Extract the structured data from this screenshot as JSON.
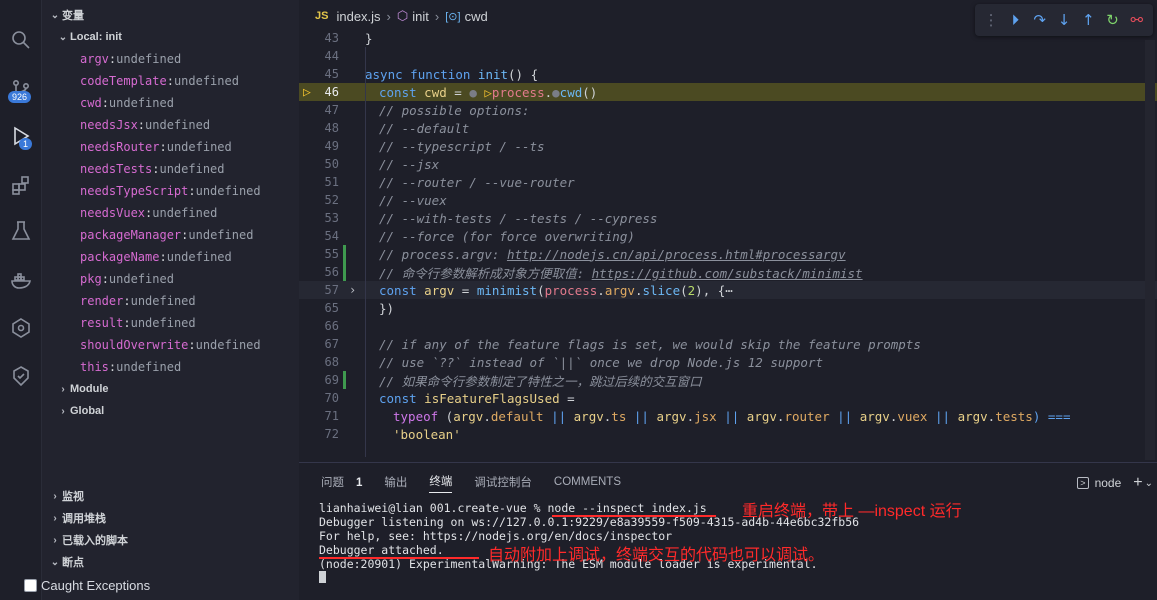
{
  "activity": {
    "scm_badge": "926",
    "debug_badge": "1"
  },
  "sidebar": {
    "variables_title": "变量",
    "local_title": "Local: init",
    "variables": [
      {
        "name": "argv",
        "value": "undefined"
      },
      {
        "name": "codeTemplate",
        "value": "undefined"
      },
      {
        "name": "cwd",
        "value": "undefined"
      },
      {
        "name": "needsJsx",
        "value": "undefined"
      },
      {
        "name": "needsRouter",
        "value": "undefined"
      },
      {
        "name": "needsTests",
        "value": "undefined"
      },
      {
        "name": "needsTypeScript",
        "value": "undefined"
      },
      {
        "name": "needsVuex",
        "value": "undefined"
      },
      {
        "name": "packageManager",
        "value": "undefined"
      },
      {
        "name": "packageName",
        "value": "undefined"
      },
      {
        "name": "pkg",
        "value": "undefined"
      },
      {
        "name": "render",
        "value": "undefined"
      },
      {
        "name": "result",
        "value": "undefined"
      },
      {
        "name": "shouldOverwrite",
        "value": "undefined"
      },
      {
        "name": "this",
        "value": "undefined"
      }
    ],
    "module_label": "Module",
    "global_label": "Global",
    "watch_title": "监视",
    "callstack_title": "调用堆栈",
    "loaded_scripts_title": "已载入的脚本",
    "breakpoints_title": "断点",
    "caught_exceptions": "Caught Exceptions"
  },
  "editor": {
    "breadcrumb": {
      "file_tag": "JS",
      "file": "index.js",
      "fn": "init",
      "var": "cwd"
    },
    "line_numbers": [
      "43",
      "44",
      "45",
      "46",
      "47",
      "48",
      "49",
      "50",
      "51",
      "52",
      "53",
      "54",
      "55",
      "56",
      "57",
      "65",
      "66",
      "67",
      "68",
      "69",
      "70",
      "71",
      "72"
    ],
    "lines": {
      "l43": "}",
      "l45_kw1": "async",
      "l45_kw2": "function",
      "l45_fn": "init",
      "l45_rest": "() {",
      "l46_kw": "const",
      "l46_var": "cwd",
      "l46_eq": " = ",
      "l46_obj": "process",
      "l46_fn": "cwd",
      "l46_rest": "()",
      "l47": "// possible options:",
      "l48": "// --default",
      "l49": "// --typescript / --ts",
      "l50": "// --jsx",
      "l51": "// --router / --vue-router",
      "l52": "// --vuex",
      "l53": "// --with-tests / --tests / --cypress",
      "l54": "// --force (for force overwriting)",
      "l55_pre": "// process.argv: ",
      "l55_link": "http://nodejs.cn/api/process.html#processargv",
      "l56_pre": "// 命令行参数解析成对象方便取值: ",
      "l56_link": "https://github.com/substack/minimist",
      "l57_kw": "const",
      "l57_var": "argv",
      "l57_eq": " = ",
      "l57_fn": "minimist",
      "l57_obj": "process",
      "l57_prop": "argv",
      "l57_fn2": "slice",
      "l57_num": "2",
      "l57_rest": "), {⋯",
      "l65": "})",
      "l67": "// if any of the feature flags is set, we would skip the feature prompts",
      "l68": "// use `??` instead of `||` once we drop Node.js 12 support",
      "l69": "// 如果命令行参数制定了特性之一，跳过后续的交互窗口",
      "l70_kw": "const",
      "l70_var": "isFeatureFlagsUsed",
      "l70_rest": " =",
      "l71_kw": "typeof",
      "l71_open": " (",
      "l71_a1": "argv",
      "l71_p1": "default",
      "l71_a2": "argv",
      "l71_p2": "ts",
      "l71_a3": "argv",
      "l71_p3": "jsx",
      "l71_a4": "argv",
      "l71_p4": "router",
      "l71_a5": "argv",
      "l71_p5": "vuex",
      "l71_a6": "argv",
      "l71_p6": "tests",
      "l71_close": ") ===",
      "l72": "'boolean'"
    }
  },
  "panel": {
    "tabs": [
      "问题",
      "输出",
      "终端",
      "调试控制台",
      "COMMENTS"
    ],
    "problems_count": "1",
    "active_tab": "终端",
    "terminal_name": "node",
    "terminal": [
      "lianhaiwei@lian 001.create-vue % node --inspect index.js",
      "Debugger listening on ws://127.0.0.1:9229/e8a39559-f509-4315-ad4b-44e6bc32fb56",
      "For help, see: https://nodejs.org/en/docs/inspector",
      "Debugger attached.",
      "(node:20901) ExperimentalWarning: The ESM module loader is experimental."
    ],
    "annotation1": "重启终端，带上 —inspect 运行",
    "annotation2": "自动附加上调试，终端交互的代码也可以调试。"
  },
  "colors": {
    "annotation": "#ff2a2a",
    "breakpoint_line": "#4b4a22",
    "accent": "#3a79d9"
  }
}
